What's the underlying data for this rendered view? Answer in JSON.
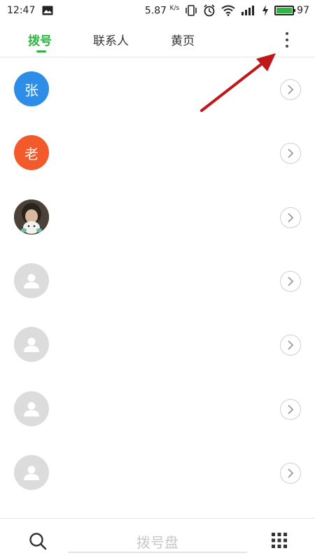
{
  "status_bar": {
    "time": "12:47",
    "network_speed": "5.87",
    "network_speed_unit": "K/s",
    "battery_level": "97",
    "battery_fraction": 0.97,
    "battery_color": "#2db640",
    "icons": [
      "image-notification-icon",
      "vibrate-icon",
      "alarm-icon",
      "wifi-icon",
      "signal-icon",
      "charging-icon",
      "battery-icon"
    ]
  },
  "tabs": [
    {
      "label": "拨号",
      "active": true
    },
    {
      "label": "联系人",
      "active": false
    },
    {
      "label": "黄页",
      "active": false
    }
  ],
  "accent_color": "#2db640",
  "more_menu": {
    "icon": "more-vertical-icon"
  },
  "call_log": [
    {
      "avatar_type": "letter",
      "avatar_text": "张",
      "avatar_color": "#2e8de6"
    },
    {
      "avatar_type": "letter",
      "avatar_text": "老",
      "avatar_color": "#f25a2b"
    },
    {
      "avatar_type": "photo",
      "avatar_text": ""
    },
    {
      "avatar_type": "default",
      "avatar_text": ""
    },
    {
      "avatar_type": "default",
      "avatar_text": ""
    },
    {
      "avatar_type": "default",
      "avatar_text": ""
    },
    {
      "avatar_type": "default",
      "avatar_text": ""
    }
  ],
  "bottom_bar": {
    "search_icon": "search-icon",
    "dialpad_label": "拨号盘",
    "dialpad_icon": "dialpad-grid-icon"
  },
  "annotation": {
    "color": "#c0171a"
  }
}
